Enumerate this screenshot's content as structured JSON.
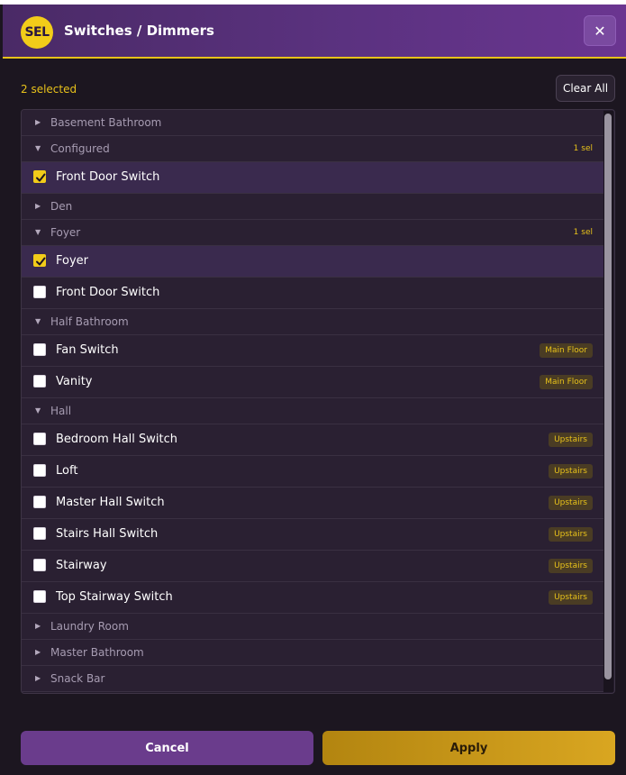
{
  "dialog": {
    "badge": "SEL",
    "title": "Switches / Dimmers",
    "close_label": "✕"
  },
  "toolbar": {
    "selected_count": "2 selected",
    "clear_all_label": "Clear All"
  },
  "list": {
    "groups": [
      {
        "label": "Basement Bathroom",
        "expanded": false
      },
      {
        "label": "Configured",
        "expanded": true,
        "sel": "1 sel",
        "items": [
          {
            "label": "Front Door Switch",
            "checked": true
          }
        ]
      },
      {
        "label": "Den",
        "expanded": false
      },
      {
        "label": "Foyer",
        "expanded": true,
        "sel": "1 sel",
        "items": [
          {
            "label": "Foyer",
            "checked": true
          },
          {
            "label": "Front Door Switch",
            "checked": false
          }
        ]
      },
      {
        "label": "Half Bathroom",
        "expanded": true,
        "items": [
          {
            "label": "Fan Switch",
            "checked": false,
            "tag": "Main Floor"
          },
          {
            "label": "Vanity",
            "checked": false,
            "tag": "Main Floor"
          }
        ]
      },
      {
        "label": "Hall",
        "expanded": true,
        "items": [
          {
            "label": "Bedroom Hall Switch",
            "checked": false,
            "tag": "Upstairs"
          },
          {
            "label": "Loft",
            "checked": false,
            "tag": "Upstairs"
          },
          {
            "label": "Master Hall Switch",
            "checked": false,
            "tag": "Upstairs"
          },
          {
            "label": "Stairs Hall Switch",
            "checked": false,
            "tag": "Upstairs"
          },
          {
            "label": "Stairway",
            "checked": false,
            "tag": "Upstairs"
          },
          {
            "label": "Top Stairway Switch",
            "checked": false,
            "tag": "Upstairs"
          }
        ]
      },
      {
        "label": "Laundry Room",
        "expanded": false
      },
      {
        "label": "Master Bathroom",
        "expanded": false
      },
      {
        "label": "Snack Bar",
        "expanded": false
      }
    ]
  },
  "footer": {
    "cancel_label": "Cancel",
    "apply_label": "Apply"
  },
  "colors": {
    "accent": "#f2cc19",
    "header": "#5b3280",
    "panel": "#241c2c"
  }
}
